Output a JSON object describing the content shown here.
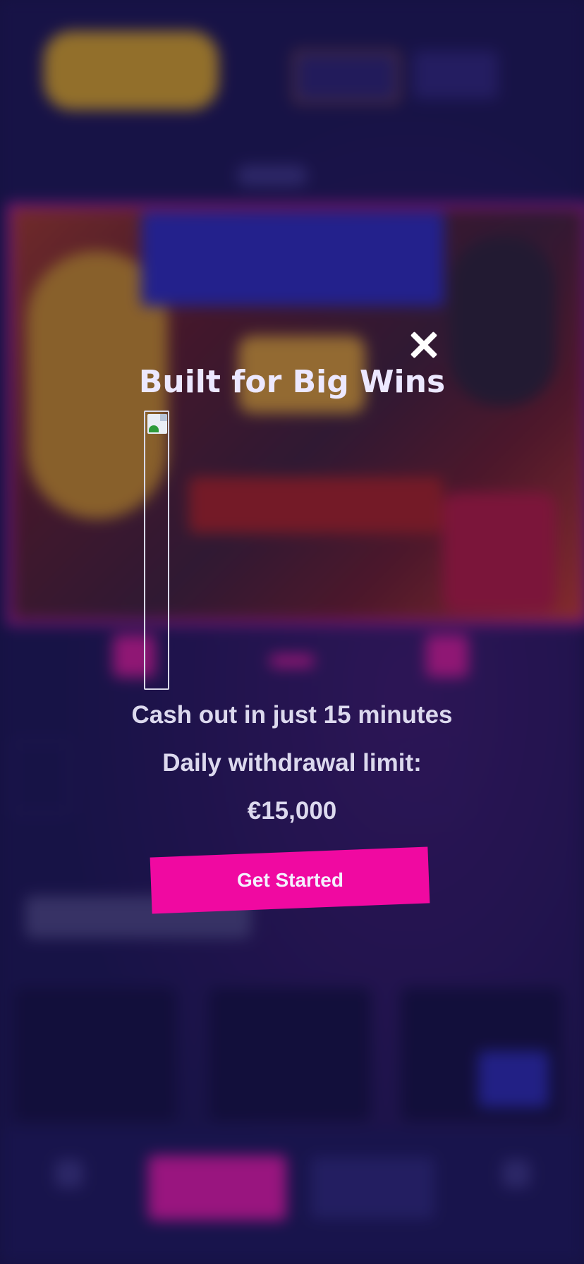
{
  "modal": {
    "title": "Built for Big Wins",
    "features": [
      "Cash out in just 15 minutes",
      "Daily withdrawal limit:",
      "€15,000"
    ],
    "cta_label": "Get Started",
    "close_icon": "close-icon",
    "image_icon": "broken-image-icon"
  },
  "colors": {
    "background": "#17123f",
    "accent": "#f009a1",
    "title": "#ece8ff"
  }
}
